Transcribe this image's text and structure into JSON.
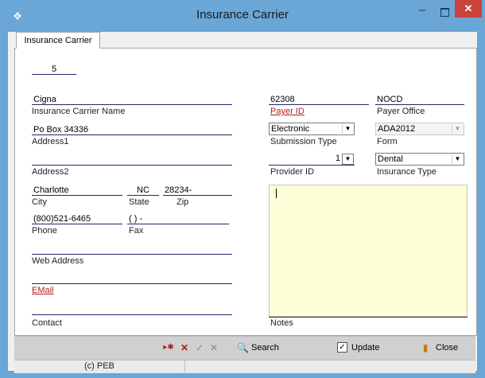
{
  "window": {
    "title": "Insurance Carrier"
  },
  "tabs": [
    {
      "label": "Insurance Carrier"
    }
  ],
  "record": {
    "id": "5"
  },
  "left": {
    "carrier_name": {
      "value": "Cigna",
      "label": "Insurance Carrier Name"
    },
    "address1": {
      "value": "Po Box 34336",
      "label": "Address1"
    },
    "address2": {
      "value": "",
      "label": "Address2"
    },
    "city": {
      "value": "Charlotte",
      "label": "City"
    },
    "state": {
      "value": "NC",
      "label": "State"
    },
    "zip": {
      "value": "28234-",
      "label": "Zip"
    },
    "phone": {
      "value": "(800)521-6465",
      "label": "Phone"
    },
    "fax": {
      "value": "(   )   -",
      "label": "Fax"
    },
    "web": {
      "value": "",
      "label": "Web Address"
    },
    "email": {
      "value": "",
      "label": "EMail"
    },
    "contact": {
      "value": "",
      "label": "Contact"
    }
  },
  "right": {
    "payer_id": {
      "value": "62308",
      "label": "Payer ID"
    },
    "payer_office": {
      "value": "NOCD",
      "label": "Payer Office"
    },
    "submission_type": {
      "value": "Electronic",
      "label": "Submission Type"
    },
    "form": {
      "value": "ADA2012",
      "label": "Form"
    },
    "provider_id": {
      "value": "1",
      "label": "Provider ID"
    },
    "insurance_type": {
      "value": "Dental",
      "label": "Insurance Type"
    },
    "notes": {
      "value": "",
      "label": "Notes"
    }
  },
  "toolbar": {
    "search_label": "Search",
    "update_label": "Update",
    "update_checked": true,
    "close_label": "Close"
  },
  "status": {
    "text": "(c) PEB"
  },
  "icons": {
    "app": "app-icon",
    "minimize": "minimize-icon",
    "maximize": "maximize-icon",
    "close": "close-icon",
    "dropdown": "chevron-down-icon"
  },
  "colors": {
    "titlebar": "#6aa6d6",
    "close": "#c9433b",
    "field_underline": "#1f2a68",
    "required_label": "#b31b1b",
    "notes_bg": "#fefed8",
    "toolbar_bg": "#d0d0d0"
  }
}
